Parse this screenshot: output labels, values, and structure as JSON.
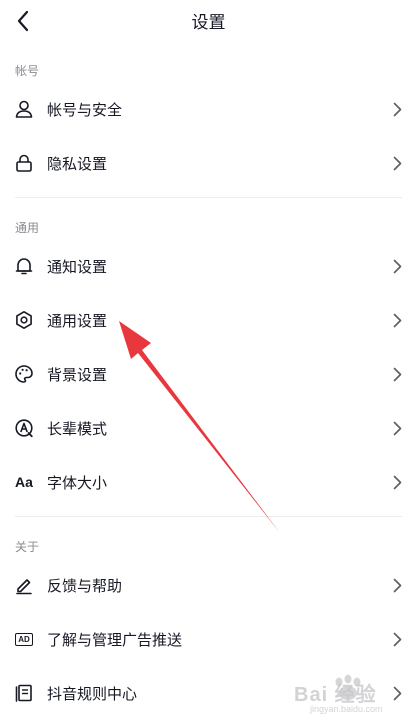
{
  "header": {
    "title": "设置",
    "back_icon": "chevron-left-icon"
  },
  "sections": [
    {
      "label": "帐号",
      "items": [
        {
          "label": "帐号与安全",
          "icon": "person-icon"
        },
        {
          "label": "隐私设置",
          "icon": "lock-icon"
        }
      ]
    },
    {
      "label": "通用",
      "items": [
        {
          "label": "通知设置",
          "icon": "bell-icon"
        },
        {
          "label": "通用设置",
          "icon": "gear-icon"
        },
        {
          "label": "背景设置",
          "icon": "palette-icon"
        },
        {
          "label": "长辈模式",
          "icon": "elder-mode-icon"
        },
        {
          "label": "字体大小",
          "icon": "font-size-icon",
          "icon_text": "Aa"
        }
      ]
    },
    {
      "label": "关于",
      "items": [
        {
          "label": "反馈与帮助",
          "icon": "pencil-icon"
        },
        {
          "label": "了解与管理广告推送",
          "icon": "ad-icon",
          "icon_text": "AD"
        },
        {
          "label": "抖音规则中心",
          "icon": "rules-book-icon"
        }
      ]
    }
  ],
  "annotation": {
    "arrow_color": "#e8373d",
    "points_to": "通用设置"
  },
  "watermark": {
    "text": "Bai 经验",
    "subtext": "jingyan.baidu.com"
  }
}
